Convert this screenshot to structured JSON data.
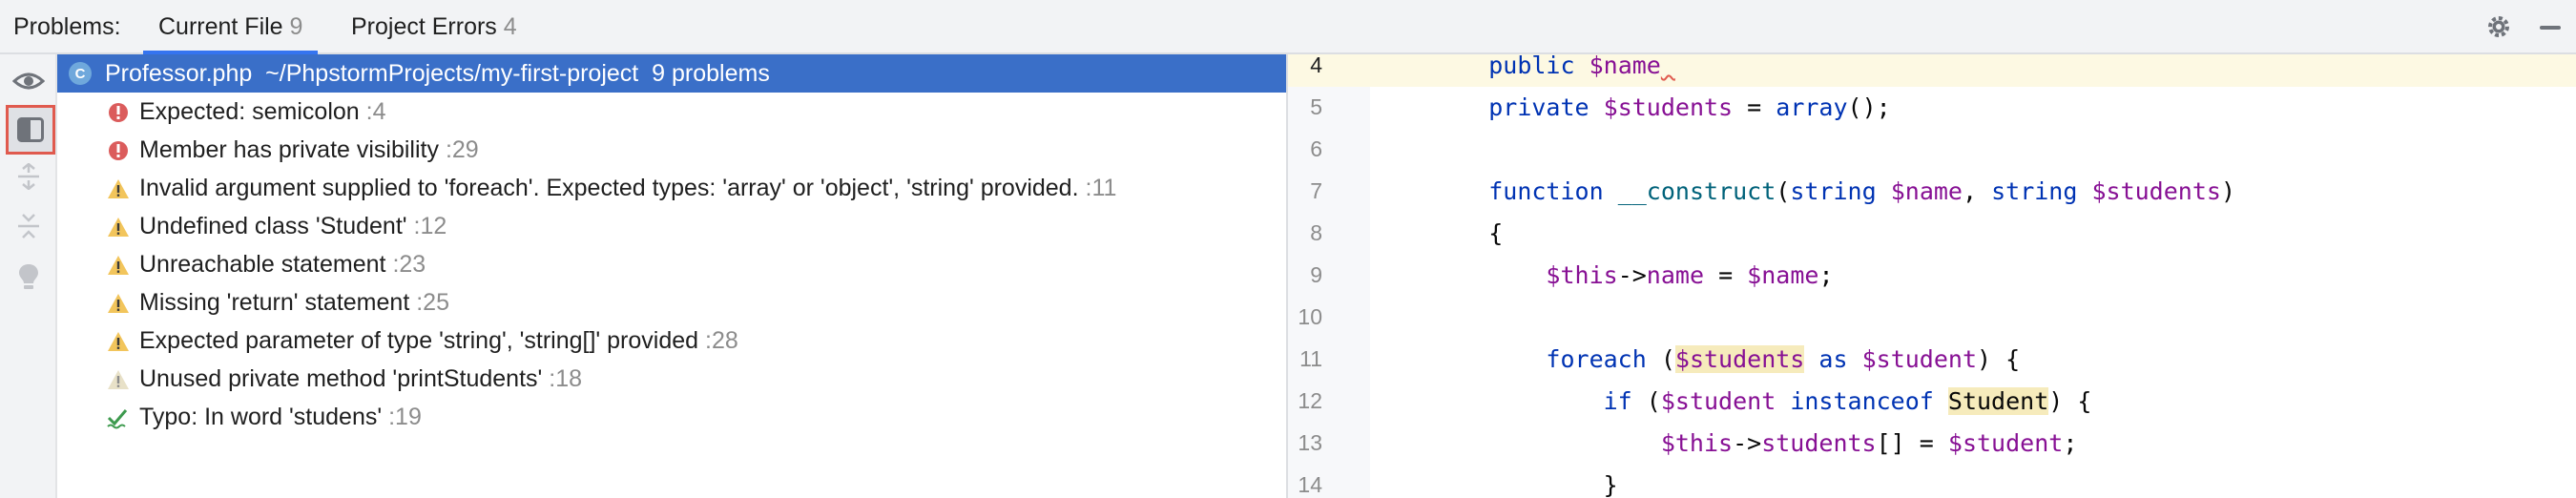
{
  "tabbar": {
    "label": "Problems:",
    "tabs": [
      {
        "label": "Current File",
        "count": "9"
      },
      {
        "label": "Project Errors",
        "count": "4"
      }
    ]
  },
  "header": {
    "file_icon_letter": "C",
    "file": "Professor.php",
    "path": "~/PhpstormProjects/my-first-project",
    "problems": "9 problems"
  },
  "problems": [
    {
      "severity": "error",
      "text": "Expected: semicolon",
      "line": ":4"
    },
    {
      "severity": "error",
      "text": "Member has private visibility",
      "line": ":29"
    },
    {
      "severity": "warning",
      "text": "Invalid argument supplied to 'foreach'. Expected types: 'array' or 'object', 'string' provided.",
      "line": ":11"
    },
    {
      "severity": "warning",
      "text": "Undefined class 'Student'",
      "line": ":12"
    },
    {
      "severity": "warning",
      "text": "Unreachable statement",
      "line": ":23"
    },
    {
      "severity": "warning",
      "text": "Missing 'return' statement",
      "line": ":25"
    },
    {
      "severity": "warning",
      "text": "Expected parameter of type 'string', 'string[]' provided",
      "line": ":28"
    },
    {
      "severity": "weak-warning",
      "text": "Unused private method 'printStudents'",
      "line": ":18"
    },
    {
      "severity": "typo",
      "text": "Typo: In word 'studens'",
      "line": ":19"
    }
  ],
  "editor": {
    "lines": [
      {
        "num": "4",
        "current": true,
        "tokens": [
          {
            "t": "    "
          },
          {
            "t": "public",
            "c": "kw"
          },
          {
            "t": " "
          },
          {
            "t": "$name",
            "c": "var"
          },
          {
            "t": " ",
            "c": "squig"
          }
        ]
      },
      {
        "num": "5",
        "tokens": [
          {
            "t": "    "
          },
          {
            "t": "private",
            "c": "kw"
          },
          {
            "t": " "
          },
          {
            "t": "$students",
            "c": "var"
          },
          {
            "t": " = "
          },
          {
            "t": "array",
            "c": "kw"
          },
          {
            "t": "();"
          }
        ]
      },
      {
        "num": "6",
        "tokens": []
      },
      {
        "num": "7",
        "tokens": [
          {
            "t": "    "
          },
          {
            "t": "function",
            "c": "kw"
          },
          {
            "t": " "
          },
          {
            "t": "__construct",
            "c": "fn"
          },
          {
            "t": "("
          },
          {
            "t": "string",
            "c": "kw"
          },
          {
            "t": " "
          },
          {
            "t": "$name",
            "c": "var"
          },
          {
            "t": ", "
          },
          {
            "t": "string",
            "c": "kw"
          },
          {
            "t": " "
          },
          {
            "t": "$students",
            "c": "var"
          },
          {
            "t": ")"
          }
        ]
      },
      {
        "num": "8",
        "tokens": [
          {
            "t": "    {"
          }
        ]
      },
      {
        "num": "9",
        "tokens": [
          {
            "t": "        "
          },
          {
            "t": "$this",
            "c": "var"
          },
          {
            "t": "->"
          },
          {
            "t": "name",
            "c": "var"
          },
          {
            "t": " = "
          },
          {
            "t": "$name",
            "c": "var"
          },
          {
            "t": ";"
          }
        ]
      },
      {
        "num": "10",
        "tokens": []
      },
      {
        "num": "11",
        "tokens": [
          {
            "t": "        "
          },
          {
            "t": "foreach",
            "c": "kw"
          },
          {
            "t": " ("
          },
          {
            "t": "$students",
            "c": "var hl"
          },
          {
            "t": " "
          },
          {
            "t": "as",
            "c": "kw"
          },
          {
            "t": " "
          },
          {
            "t": "$student",
            "c": "var"
          },
          {
            "t": ") {"
          }
        ]
      },
      {
        "num": "12",
        "tokens": [
          {
            "t": "            "
          },
          {
            "t": "if",
            "c": "kw"
          },
          {
            "t": " ("
          },
          {
            "t": "$student",
            "c": "var"
          },
          {
            "t": " "
          },
          {
            "t": "instanceof",
            "c": "kw"
          },
          {
            "t": " "
          },
          {
            "t": "Student",
            "c": "hl"
          },
          {
            "t": ") {"
          }
        ]
      },
      {
        "num": "13",
        "tokens": [
          {
            "t": "                "
          },
          {
            "t": "$this",
            "c": "var"
          },
          {
            "t": "->"
          },
          {
            "t": "students",
            "c": "var"
          },
          {
            "t": "[] = "
          },
          {
            "t": "$student",
            "c": "var"
          },
          {
            "t": ";"
          }
        ]
      },
      {
        "num": "14",
        "tokens": [
          {
            "t": "            }"
          }
        ]
      }
    ]
  },
  "colors": {
    "accent": "#3574f0",
    "error": "#e05a4e",
    "warning": "#f2c55c",
    "selection": "#3a6fc8"
  }
}
